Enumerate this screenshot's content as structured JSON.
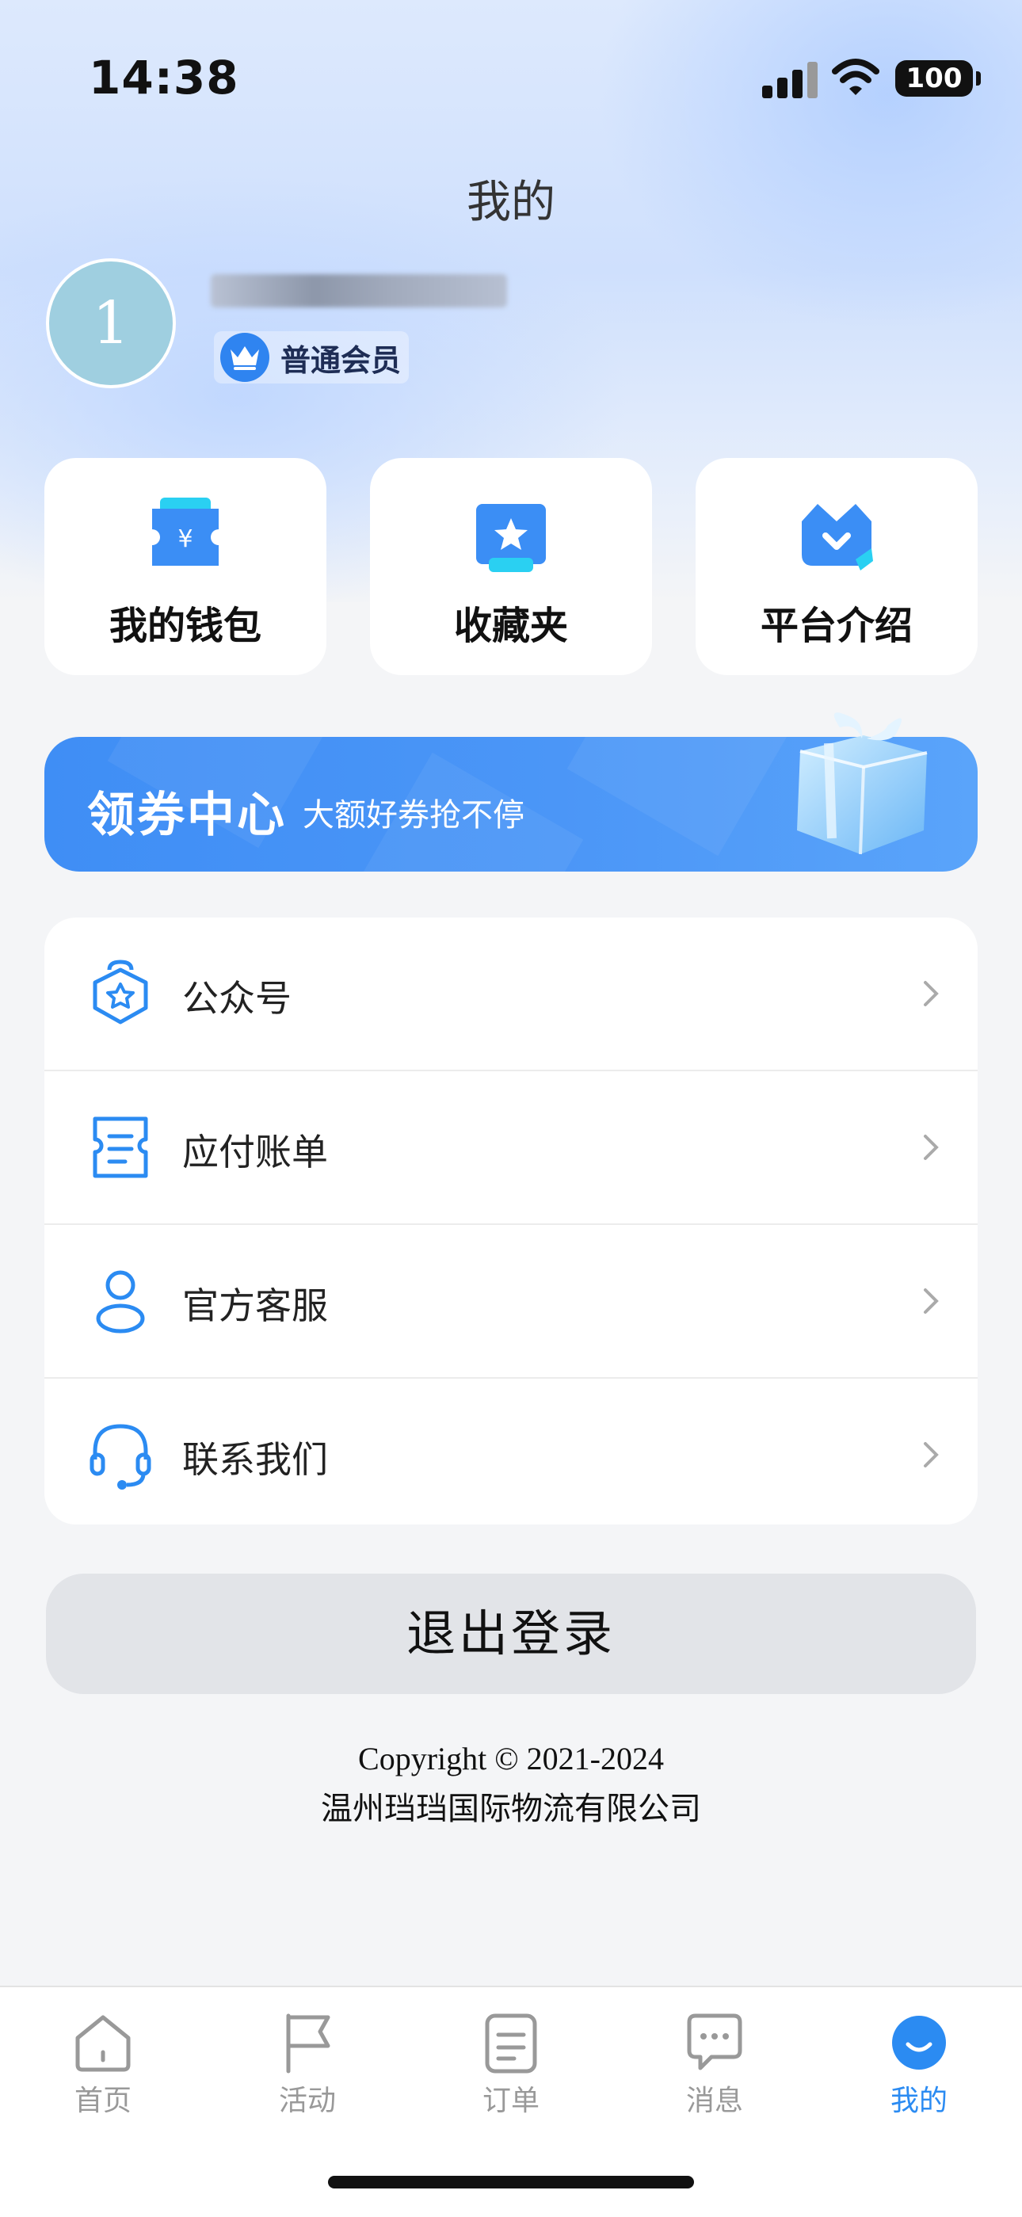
{
  "status_bar": {
    "time": "14:38",
    "battery": "100",
    "icons": [
      "cellular-signal-icon",
      "wifi-icon",
      "battery-icon"
    ]
  },
  "page": {
    "title": "我的"
  },
  "profile": {
    "avatar_text": "1",
    "member_level": "普通会员",
    "member_icon": "crown-icon"
  },
  "quick_actions": [
    {
      "label": "我的钱包",
      "icon": "wallet-ticket-icon"
    },
    {
      "label": "收藏夹",
      "icon": "favorites-star-icon"
    },
    {
      "label": "平台介绍",
      "icon": "crown-badge-icon"
    }
  ],
  "banner": {
    "title": "领券中心",
    "subtitle": "大额好券抢不停",
    "icon": "gift-box-icon"
  },
  "menu": [
    {
      "label": "公众号",
      "icon": "public-account-icon"
    },
    {
      "label": "应付账单",
      "icon": "bill-receipt-icon"
    },
    {
      "label": "官方客服",
      "icon": "person-icon"
    },
    {
      "label": "联系我们",
      "icon": "headset-icon"
    }
  ],
  "logout": {
    "label": "退出登录"
  },
  "footer": {
    "copyright": "Copyright © 2021-2024",
    "company": "温州珰珰国际物流有限公司"
  },
  "tabbar": {
    "items": [
      {
        "label": "首页",
        "icon": "home-icon"
      },
      {
        "label": "活动",
        "icon": "flag-icon"
      },
      {
        "label": "订单",
        "icon": "order-document-icon"
      },
      {
        "label": "消息",
        "icon": "message-bubble-icon"
      },
      {
        "label": "我的",
        "icon": "profile-smile-icon",
        "active": true
      }
    ]
  },
  "colors": {
    "accent": "#2b8bf2",
    "banner": "#4b96f7",
    "logout_bg": "#e2e4e8",
    "inactive_tab": "#999999"
  }
}
